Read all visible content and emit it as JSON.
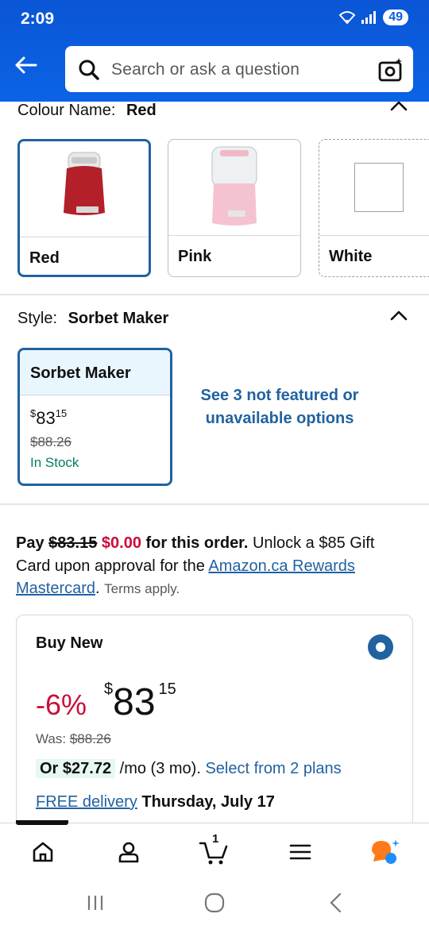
{
  "status": {
    "time": "2:09",
    "battery": "49"
  },
  "search": {
    "placeholder": "Search or ask a question"
  },
  "colour": {
    "label": "Colour Name:",
    "selected": "Red",
    "options": [
      {
        "name": "Red",
        "selected": true,
        "color": "#c8242e"
      },
      {
        "name": "Pink",
        "selected": false,
        "color": "#f3c7d2"
      },
      {
        "name": "White",
        "selected": false,
        "color": "#ffffff"
      }
    ]
  },
  "style": {
    "label": "Style:",
    "selected": "Sorbet Maker",
    "card": {
      "title": "Sorbet Maker",
      "currency": "$",
      "price_whole": "83",
      "price_fraction": "15",
      "was": "$88.26",
      "stock": "In Stock"
    },
    "see_more": "See 3 not featured or unavailable options"
  },
  "promo": {
    "pay": "Pay",
    "old_price": "$83.15",
    "new_price": "$0.00",
    "for_order": "for this order.",
    "unlock": "Unlock a $85 Gift Card upon approval for the",
    "link": "Amazon.ca Rewards Mastercard",
    "terms": "Terms apply."
  },
  "buy_box": {
    "title": "Buy New",
    "discount": "-6%",
    "currency": "$",
    "price_whole": "83",
    "price_fraction": "15",
    "was_label": "Was:",
    "was_price": "$88.26",
    "plan_amount": "Or $27.72",
    "plan_terms": "/mo (3 mo).",
    "plan_link": "Select from 2 plans",
    "delivery_link": "FREE delivery",
    "delivery_date": "Thursday, July 17"
  },
  "bottom_nav": {
    "cart_count": "1",
    "items": [
      "home-icon",
      "account-icon",
      "cart-icon",
      "menu-icon",
      "rufus-icon"
    ]
  },
  "colors": {
    "accent": "#2162a1",
    "header": "#0b63e5",
    "deal_red": "#cc0c39",
    "stock_green": "#067d62"
  }
}
